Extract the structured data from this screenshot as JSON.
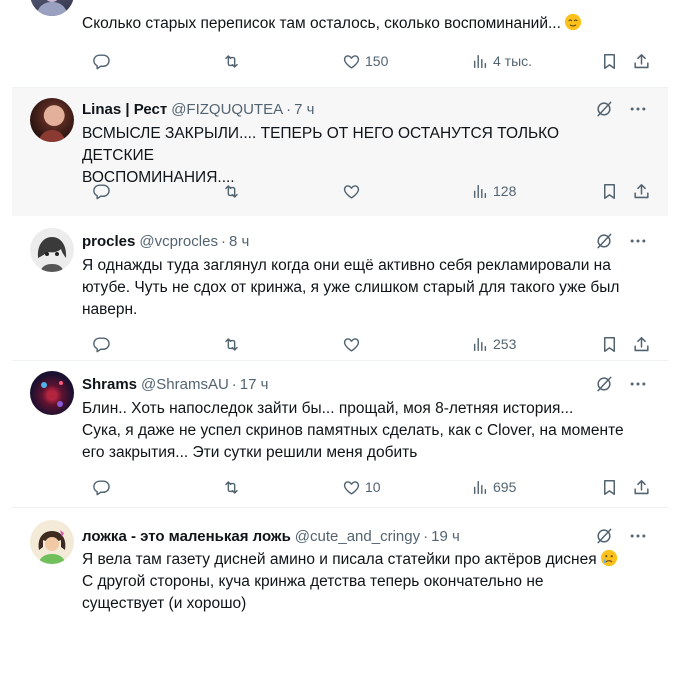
{
  "tweets": [
    {
      "name": "",
      "handle": "",
      "time": "",
      "lines": [
        "Сколько старых переписок там осталось, сколько воспоминаний..."
      ],
      "replies": "",
      "retweets": "",
      "likes": "150",
      "views": "4 тыс.",
      "avatar": "avatar-partial",
      "emoji": "relieved-face-emoji"
    },
    {
      "name": "Linas | Рест",
      "handle": "@FIZQUQUTEA",
      "time": "7 ч",
      "lines": [
        "ВСМЫСЛЕ ЗАКРЫЛИ.... ТЕПЕРЬ ОТ НЕГО ОСТАНУТСЯ ТОЛЬКО ДЕТСКИЕ",
        "ВОСПОМИНАНИЯ...."
      ],
      "replies": "",
      "retweets": "",
      "likes": "",
      "views": "128",
      "avatar": "avatar-linas"
    },
    {
      "name": "procles",
      "handle": "@vcprocles",
      "time": "8 ч",
      "lines": [
        "Я однажды туда заглянул когда они ещё активно себя рекламировали на",
        "ютубе. Чуть не сдох от кринжа, я уже слишком старый для такого уже был",
        "наверн."
      ],
      "replies": "",
      "retweets": "",
      "likes": "",
      "views": "253",
      "avatar": "avatar-procles"
    },
    {
      "name": "Shrams",
      "handle": "@ShramsAU",
      "time": "17 ч",
      "lines": [
        "Блин.. Хоть напоследок зайти бы... прощай, моя 8-летняя история...",
        "Сука, я даже не успел скринов памятных сделать, как с Clover, на моменте",
        "его закрытия... Эти сутки решили меня добить"
      ],
      "replies": "",
      "retweets": "",
      "likes": "10",
      "views": "695",
      "avatar": "avatar-shrams"
    },
    {
      "name": "ложка - это маленькая ложь",
      "handle": "@cute_and_cringy",
      "time": "19 ч",
      "lines": [
        "Я вела там газету дисней амино и писала статейки про актёров диснея",
        "С другой стороны, куча кринжа детства теперь окончательно не",
        "существует (и хорошо)"
      ],
      "avatar": "avatar-lozhka",
      "emoji": "crying-face-emoji"
    }
  ],
  "icons": {
    "grok": "grok-icon",
    "more": "more-icon",
    "reply": "reply-icon",
    "retweet": "retweet-icon",
    "like": "heart-icon",
    "views": "views-icon",
    "bookmark": "bookmark-icon",
    "share": "share-icon"
  },
  "colors": {
    "text": "#0f1419",
    "muted": "#536471",
    "highlight_bg": "#f7f7f7",
    "divider": "#eff3f4"
  }
}
